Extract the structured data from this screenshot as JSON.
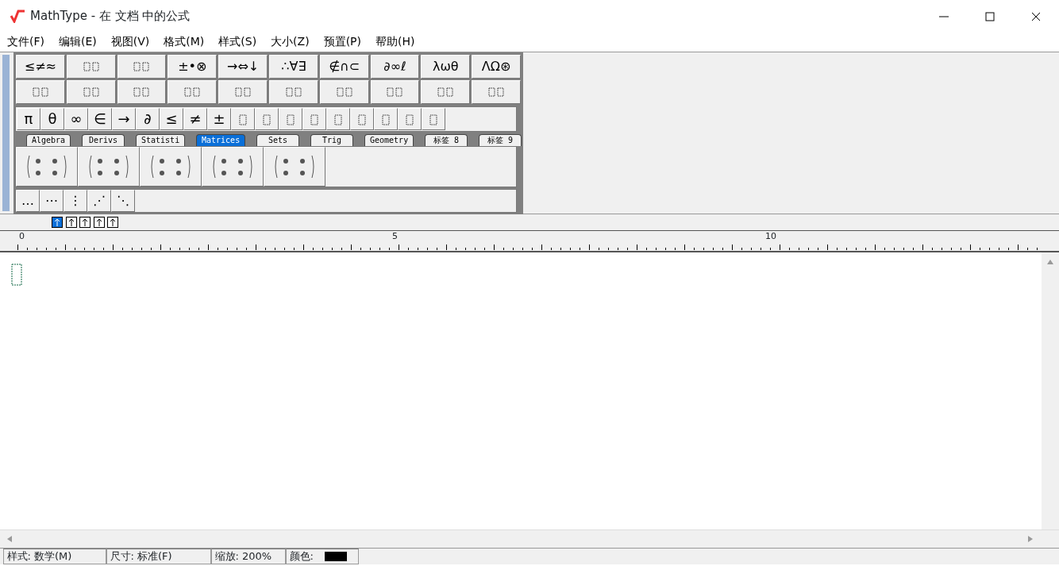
{
  "window": {
    "title": "MathType - 在 文档 中的公式"
  },
  "menu": [
    "文件(F)",
    "编辑(E)",
    "视图(V)",
    "格式(M)",
    "样式(S)",
    "大小(Z)",
    "预置(P)",
    "帮助(H)"
  ],
  "palette_row_1": [
    {
      "kind": "symbols",
      "text": "≤≠≈"
    },
    {
      "kind": "template"
    },
    {
      "kind": "template"
    },
    {
      "kind": "symbols",
      "text": "±•⊗"
    },
    {
      "kind": "symbols",
      "text": "→⇔↓"
    },
    {
      "kind": "symbols",
      "text": "∴∀∃"
    },
    {
      "kind": "symbols",
      "text": "∉∩⊂"
    },
    {
      "kind": "symbols",
      "text": "∂∞ℓ"
    },
    {
      "kind": "symbols",
      "text": "λωθ"
    },
    {
      "kind": "symbols",
      "text": "ΛΩ⊛"
    }
  ],
  "palette_row_2": [
    {
      "kind": "template"
    },
    {
      "kind": "template"
    },
    {
      "kind": "template"
    },
    {
      "kind": "template"
    },
    {
      "kind": "template"
    },
    {
      "kind": "template"
    },
    {
      "kind": "template"
    },
    {
      "kind": "template"
    },
    {
      "kind": "template"
    },
    {
      "kind": "template"
    }
  ],
  "small_bar": [
    {
      "kind": "symbol",
      "text": "π"
    },
    {
      "kind": "symbol",
      "text": "θ"
    },
    {
      "kind": "symbol",
      "text": "∞"
    },
    {
      "kind": "symbol",
      "text": "∈"
    },
    {
      "kind": "symbol",
      "text": "→"
    },
    {
      "kind": "symbol",
      "text": "∂"
    },
    {
      "kind": "symbol",
      "text": "≤"
    },
    {
      "kind": "symbol",
      "text": "≠"
    },
    {
      "kind": "symbol",
      "text": "±"
    },
    {
      "kind": "template"
    },
    {
      "kind": "template"
    },
    {
      "kind": "template"
    },
    {
      "kind": "template"
    },
    {
      "kind": "template"
    },
    {
      "kind": "template"
    },
    {
      "kind": "template"
    },
    {
      "kind": "template"
    },
    {
      "kind": "template"
    }
  ],
  "tabs": [
    {
      "label": "Algebra",
      "selected": false
    },
    {
      "label": "Derivs",
      "selected": false
    },
    {
      "label": "Statisti",
      "selected": false
    },
    {
      "label": "Matrices",
      "selected": true
    },
    {
      "label": "Sets",
      "selected": false
    },
    {
      "label": "Trig",
      "selected": false
    },
    {
      "label": "Geometry",
      "selected": false
    },
    {
      "label": "标签 8",
      "selected": false
    },
    {
      "label": "标签 9",
      "selected": false
    }
  ],
  "matrix_templates": [
    {
      "kind": "template"
    },
    {
      "kind": "template"
    },
    {
      "kind": "template"
    },
    {
      "kind": "template"
    },
    {
      "kind": "template"
    }
  ],
  "dots_row": [
    "…",
    "⋯",
    "⋮",
    "⋰",
    "⋱"
  ],
  "nudge_buttons": [
    {
      "selected": true
    },
    {
      "selected": false
    },
    {
      "selected": false
    },
    {
      "selected": false
    },
    {
      "selected": false
    }
  ],
  "ruler": {
    "labels": [
      "0",
      "5",
      "10"
    ]
  },
  "status_bar": [
    "样式: 数学(M)",
    "尺寸: 标准(F)",
    "缩放: 200%",
    "颜色:"
  ]
}
